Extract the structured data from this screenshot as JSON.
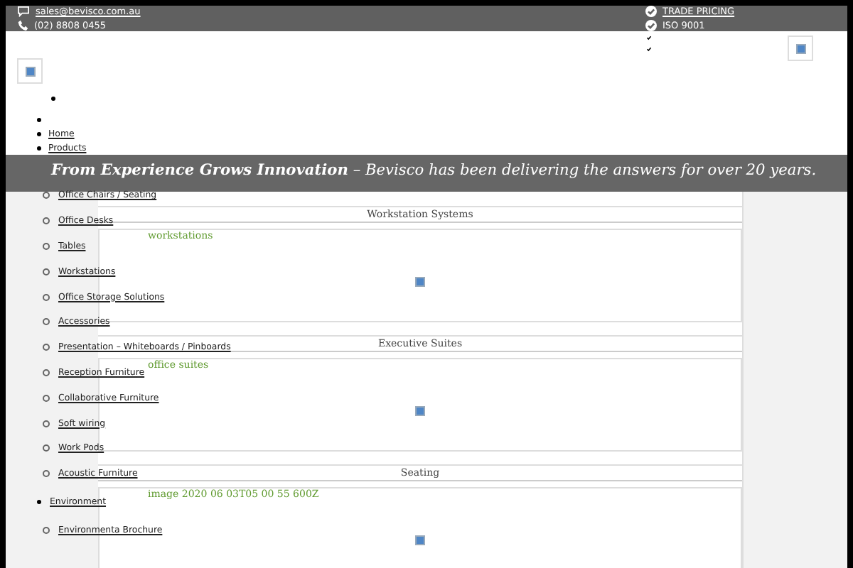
{
  "top_bar": {
    "email": "sales@bevisco.com.au",
    "phone": "(02) 8808 0455",
    "badges": [
      {
        "label": "TRADE PRICING",
        "link": true
      },
      {
        "label": "ISO 9001",
        "link": false
      }
    ]
  },
  "nav": [
    {
      "label": "Home"
    },
    {
      "label": "Products"
    }
  ],
  "banner": {
    "text": "**From Experience Grows Innovation** – Bevisco has been delivering the answers for over 20 years."
  },
  "sidebar": [
    {
      "label": "Office Chairs / Seating",
      "kind": "sub"
    },
    {
      "label": "Office Desks",
      "kind": "sub"
    },
    {
      "label": "Tables",
      "kind": "sub"
    },
    {
      "label": "Workstations",
      "kind": "sub"
    },
    {
      "label": "Office Storage Solutions",
      "kind": "sub"
    },
    {
      "label": "Accessories",
      "kind": "sub"
    },
    {
      "label": "Presentation – Whiteboards / Pinboards",
      "kind": "sub"
    },
    {
      "label": "Reception Furniture",
      "kind": "sub"
    },
    {
      "label": "Collaborative Furniture",
      "kind": "sub"
    },
    {
      "label": "Soft wiring",
      "kind": "sub"
    },
    {
      "label": "Work Pods",
      "kind": "sub"
    },
    {
      "label": "Acoustic Furniture",
      "kind": "sub"
    },
    {
      "label": "Environment",
      "kind": "top"
    },
    {
      "label": "Environmenta Brochure",
      "kind": "sub"
    }
  ],
  "sections": [
    {
      "title": "Workstation Systems",
      "caption": "workstations"
    },
    {
      "title": "Executive Suites",
      "caption": "office suites"
    },
    {
      "title": "Seating",
      "caption": "image 2020 06 03T05 00 55 600Z"
    }
  ]
}
